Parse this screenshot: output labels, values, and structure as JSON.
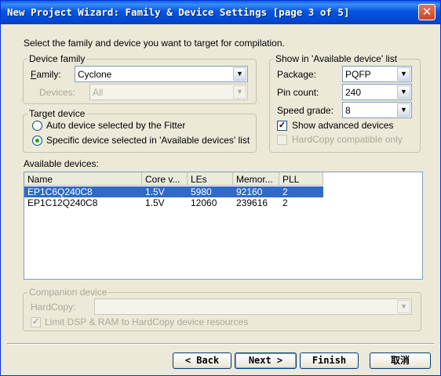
{
  "window": {
    "title": "New Project Wizard: Family & Device Settings [page 3 of 5]",
    "close_glyph": "✕"
  },
  "intro": "Select the family and device you want to target for compilation.",
  "device_family": {
    "title": "Device family",
    "family_label": "Family:",
    "family_value": "Cyclone",
    "devices_label": "Devices:",
    "devices_value": "All"
  },
  "show_available": {
    "title": "Show in 'Available device' list",
    "package_label": "Package:",
    "package_value": "PQFP",
    "pin_count_label": "Pin count:",
    "pin_count_value": "240",
    "speed_grade_label": "Speed grade:",
    "speed_grade_value": "8",
    "show_advanced_label": "Show advanced devices",
    "show_advanced_checked": true,
    "hardcopy_compatible_label": "HardCopy compatible only",
    "hardcopy_compatible_checked": false
  },
  "target_device": {
    "title": "Target device",
    "auto_label": "Auto device selected by the Fitter",
    "specific_label": "Specific device selected in 'Available devices' list",
    "selected": "specific"
  },
  "available_devices": {
    "label": "Available devices:",
    "columns": [
      "Name",
      "Core v...",
      "LEs",
      "Memor...",
      "PLL"
    ],
    "rows": [
      [
        "EP1C6Q240C8",
        "1.5V",
        "5980",
        "92160",
        "2"
      ],
      [
        "EP1C12Q240C8",
        "1.5V",
        "12060",
        "239616",
        "2"
      ]
    ],
    "selected_row": 0
  },
  "companion": {
    "title": "Companion device",
    "hardcopy_label": "HardCopy:",
    "hardcopy_value": "",
    "limit_label": "Limit DSP & RAM to HardCopy device resources",
    "limit_checked": true
  },
  "buttons": {
    "back": "< Back",
    "next": "Next >",
    "finish": "Finish",
    "cancel": "取消"
  },
  "icons": {
    "dropdown": "chevron-down-icon",
    "check": "checkmark-icon"
  },
  "colors": {
    "title_bar": "#0456e0",
    "selection": "#316ac5",
    "dialog_bg": "#ece9d8"
  }
}
